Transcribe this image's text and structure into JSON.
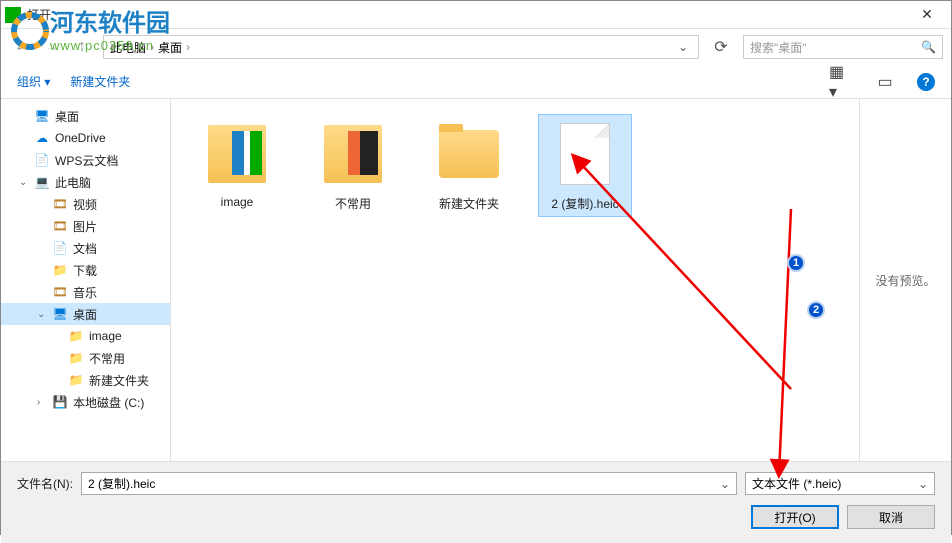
{
  "title": "打开",
  "watermark": {
    "text": "河东软件园",
    "url": "www.pc0359.cn"
  },
  "nav": {
    "breadcrumb": [
      "此电脑",
      "桌面"
    ],
    "search_placeholder": "搜索\"桌面\""
  },
  "toolbar": {
    "organize": "组织 ▾",
    "newfolder": "新建文件夹"
  },
  "sidebar": {
    "items": [
      {
        "label": "桌面",
        "icon": "desktop",
        "indent": 1
      },
      {
        "label": "OneDrive",
        "icon": "cloud",
        "indent": 1
      },
      {
        "label": "WPS云文档",
        "icon": "doc",
        "indent": 1
      },
      {
        "label": "此电脑",
        "icon": "pc",
        "indent": 1,
        "exp": "⌄"
      },
      {
        "label": "视频",
        "icon": "media",
        "indent": 2
      },
      {
        "label": "图片",
        "icon": "media",
        "indent": 2
      },
      {
        "label": "文档",
        "icon": "doc",
        "indent": 2
      },
      {
        "label": "下载",
        "icon": "folder",
        "indent": 2
      },
      {
        "label": "音乐",
        "icon": "media",
        "indent": 2
      },
      {
        "label": "桌面",
        "icon": "desktop",
        "indent": 2,
        "selected": true,
        "exp": "⌄"
      },
      {
        "label": "image",
        "icon": "folder",
        "indent": 3
      },
      {
        "label": "不常用",
        "icon": "folder",
        "indent": 3
      },
      {
        "label": "新建文件夹",
        "icon": "folder",
        "indent": 3
      },
      {
        "label": "本地磁盘 (C:)",
        "icon": "drive",
        "indent": 2,
        "exp": "›"
      }
    ]
  },
  "files": [
    {
      "label": "image",
      "type": "folder-img1"
    },
    {
      "label": "不常用",
      "type": "folder-img2"
    },
    {
      "label": "新建文件夹",
      "type": "folder"
    },
    {
      "label": "2 (复制).heic",
      "type": "file",
      "selected": true
    }
  ],
  "preview": {
    "text": "没有预览。"
  },
  "annotations": {
    "badge1": "1",
    "badge2": "2"
  },
  "bottom": {
    "filename_label": "文件名(N):",
    "filename_value": "2 (复制).heic",
    "filetype_value": "文本文件 (*.heic)",
    "open_btn": "打开(O)",
    "cancel_btn": "取消"
  }
}
